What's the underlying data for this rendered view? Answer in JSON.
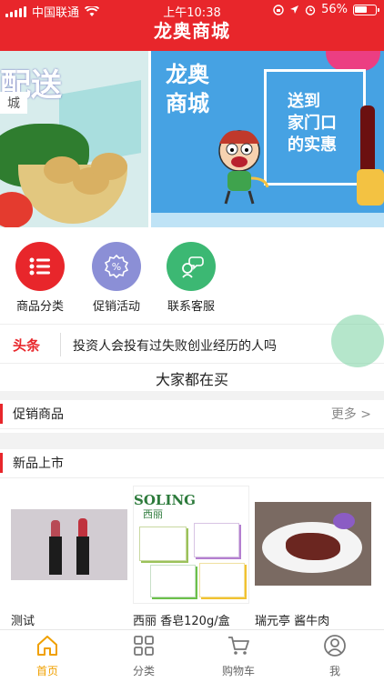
{
  "status_bar": {
    "carrier": "中国联通",
    "time": "上午10:38",
    "battery": "56%"
  },
  "header": {
    "title": "龙奥商城"
  },
  "banner": {
    "left": {
      "big_text": "配送",
      "tag_text": "城"
    },
    "right": {
      "brand_line1": "龙奥",
      "brand_line2": "商城",
      "slogan_line1": "送到",
      "slogan_line2": "家门口",
      "slogan_line3": "的实惠"
    }
  },
  "shortcuts": [
    {
      "label": "商品分类",
      "icon": "list-icon",
      "color": "#e8262b"
    },
    {
      "label": "促销活动",
      "icon": "discount-icon",
      "color": "#8b8fd6"
    },
    {
      "label": "联系客服",
      "icon": "chat-icon",
      "color": "#3cb873"
    }
  ],
  "headline": {
    "tag": "头条",
    "text": "投资人会投有过失败创业经历的人吗"
  },
  "everyone_buying": "大家都在买",
  "promo_section": {
    "title": "促销商品",
    "more": "更多 >"
  },
  "new_section": {
    "title": "新品上市"
  },
  "products": [
    {
      "name": "测试"
    },
    {
      "name": "西丽 香皂120g/盒"
    },
    {
      "name": "瑞元亭 酱牛肉"
    }
  ],
  "soap_brand": "SOLING",
  "soap_brand_cn": "西丽",
  "tabbar": {
    "items": [
      {
        "label": "首页",
        "icon": "home-icon",
        "active": true
      },
      {
        "label": "分类",
        "icon": "grid-icon",
        "active": false
      },
      {
        "label": "购物车",
        "icon": "cart-icon",
        "active": false
      },
      {
        "label": "我",
        "icon": "user-icon",
        "active": false
      }
    ]
  },
  "colors": {
    "brand_red": "#e8262b",
    "active_tab": "#f0a000"
  }
}
